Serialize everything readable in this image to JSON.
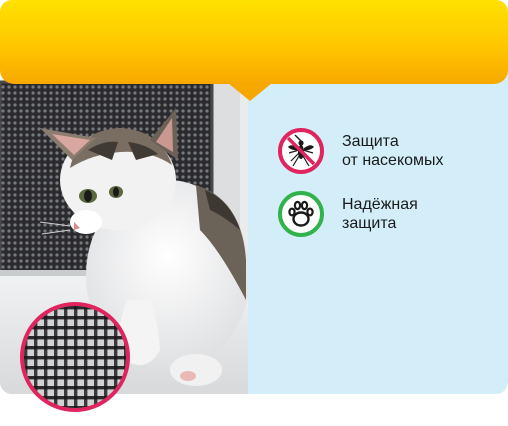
{
  "features": [
    {
      "icon": "no-insect-icon",
      "line1": "Защита",
      "line2": "от насекомых",
      "color": "#e0245e"
    },
    {
      "icon": "paw-icon",
      "line1": "Надёжная",
      "line2": "защита",
      "color": "#2fb34a"
    }
  ],
  "colors": {
    "banner_top": "#ffe100",
    "banner_bottom": "#f7a800",
    "panel_bg": "#d4eef9",
    "mesh_ring": "#e0245e"
  },
  "images": {
    "photo": "kitten-at-window-with-mosquito-net",
    "detail": "mesh-closeup"
  }
}
